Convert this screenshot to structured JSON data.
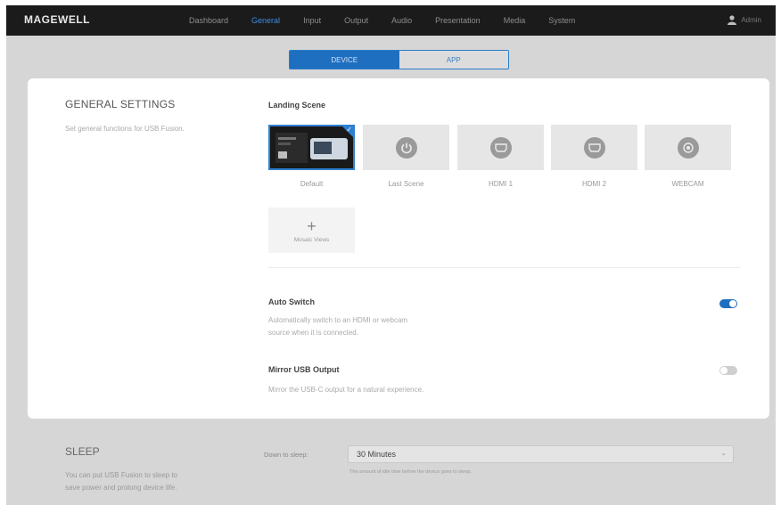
{
  "brand": "MAGEWELL",
  "nav": {
    "items": [
      {
        "label": "Dashboard",
        "active": false
      },
      {
        "label": "General",
        "active": true
      },
      {
        "label": "Input",
        "active": false
      },
      {
        "label": "Output",
        "active": false
      },
      {
        "label": "Audio",
        "active": false
      },
      {
        "label": "Presentation",
        "active": false
      },
      {
        "label": "Media",
        "active": false
      },
      {
        "label": "System",
        "active": false
      }
    ]
  },
  "user": {
    "name": "Admin",
    "icon": "user-icon"
  },
  "segment": {
    "device": "DEVICE",
    "app": "APP",
    "selected": "DEVICE"
  },
  "general": {
    "title": "GENERAL SETTINGS",
    "description": "Set general functions for USB Fusion.",
    "landing_scene": {
      "label": "Landing Scene",
      "scenes": [
        {
          "label": "Default",
          "icon": "default-scene-thumbnail",
          "selected": true
        },
        {
          "label": "Last Scene",
          "icon": "power-icon",
          "selected": false
        },
        {
          "label": "HDMI 1",
          "icon": "hdmi-icon",
          "selected": false
        },
        {
          "label": "HDMI 2",
          "icon": "hdmi-icon",
          "selected": false
        },
        {
          "label": "WEBCAM",
          "icon": "webcam-icon",
          "selected": false
        }
      ],
      "add_view_label": "Mosaic Views"
    },
    "auto_switch": {
      "label": "Auto Switch",
      "description_line1": "Automatically switch to an HDMI or webcam",
      "description_line2": "source when it is connected.",
      "enabled": true
    },
    "mirror_usb": {
      "label": "Mirror USB Output",
      "description": "Mirror the USB-C output for a natural experience.",
      "enabled": false
    }
  },
  "sleep": {
    "title": "SLEEP",
    "description_line1": "You can put USB Fusion to sleep to",
    "description_line2": "save power and prolong device life.",
    "field_label": "Down to sleep:",
    "value": "30 Minutes",
    "hint": "The amount of idle time before the device goes to sleep."
  },
  "colors": {
    "accent": "#1f6fc0",
    "topbar": "#1b1b1b",
    "background": "#d6d6d6"
  }
}
